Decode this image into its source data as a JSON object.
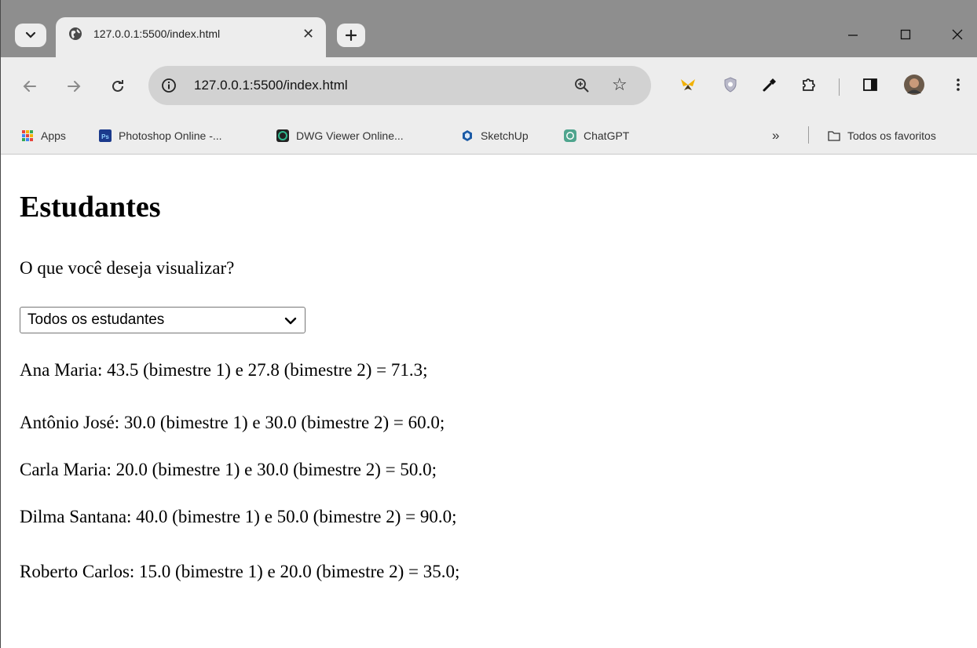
{
  "browser": {
    "tab_title": "127.0.0.1:5500/index.html",
    "url": "127.0.0.1:5500/index.html",
    "bookmarks": [
      {
        "label": "Apps",
        "icon": "apps-grid-icon",
        "color": "#e8453c"
      },
      {
        "label": "Photoshop Online -...",
        "icon": "photoshop-icon",
        "color": "#1b3a8c"
      },
      {
        "label": "DWG Viewer Online...",
        "icon": "dwg-viewer-icon",
        "color": "#1e6b5a"
      },
      {
        "label": "SketchUp",
        "icon": "sketchup-icon",
        "color": "#1a5aa6"
      },
      {
        "label": "ChatGPT",
        "icon": "chatgpt-icon",
        "color": "#4fa58e"
      }
    ],
    "bookmarks_overflow": "»",
    "all_bookmarks_label": "Todos os favoritos"
  },
  "page": {
    "title": "Estudantes",
    "prompt": "O que você deseja visualizar?",
    "select": {
      "selected": "Todos os estudantes"
    },
    "students": [
      {
        "text": "Ana Maria: 43.5 (bimestre 1) e 27.8 (bimestre 2) = 71.3;"
      },
      {
        "text": "Antônio José: 30.0 (bimestre 1) e 30.0 (bimestre 2) = 60.0;"
      },
      {
        "text": "Carla Maria: 20.0 (bimestre 1) e 30.0 (bimestre 2) = 50.0;"
      },
      {
        "text": "Dilma Santana: 40.0 (bimestre 1) e 50.0 (bimestre 2) = 90.0;"
      },
      {
        "text": "Roberto Carlos: 15.0 (bimestre 1) e 20.0 (bimestre 2) = 35.0;"
      }
    ]
  }
}
